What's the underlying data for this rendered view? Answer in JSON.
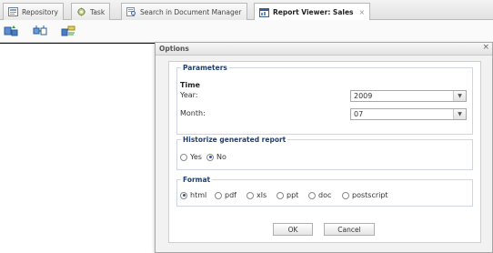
{
  "tabs": [
    {
      "label": "Repository",
      "icon": "repository-icon"
    },
    {
      "label": "Task",
      "icon": "task-icon"
    },
    {
      "label": "Search in Document Manager",
      "icon": "search-document-icon"
    },
    {
      "label": "Report Viewer: Sales",
      "icon": "report-viewer-icon",
      "active": true,
      "close": "×"
    }
  ],
  "toolbar": {
    "icons": [
      "refresh-report-icon",
      "export-report-icon",
      "report-options-icon"
    ]
  },
  "dialog": {
    "title": "Options",
    "close": "×",
    "parameters": {
      "legend": "Parameters",
      "group_label": "Time",
      "year_label": "Year:",
      "year_value": "2009",
      "month_label": "Month:",
      "month_value": "07"
    },
    "historize": {
      "legend": "Historize generated report",
      "options": [
        {
          "label": "Yes",
          "selected": false
        },
        {
          "label": "No",
          "selected": true
        }
      ]
    },
    "format": {
      "legend": "Format",
      "options": [
        {
          "label": "html",
          "selected": true
        },
        {
          "label": "pdf",
          "selected": false
        },
        {
          "label": "xls",
          "selected": false
        },
        {
          "label": "ppt",
          "selected": false
        },
        {
          "label": "doc",
          "selected": false
        },
        {
          "label": "postscript",
          "selected": false
        }
      ]
    },
    "ok_label": "OK",
    "cancel_label": "Cancel"
  },
  "colors": {
    "legend_text": "#22406e",
    "radio_selected": "#2a58a8",
    "dialog_bg": "#f2f2f2"
  }
}
